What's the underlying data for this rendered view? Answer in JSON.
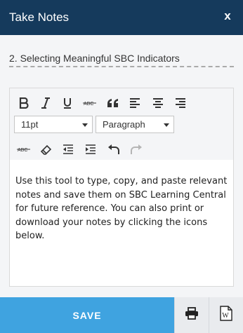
{
  "header": {
    "title": "Take Notes",
    "close_label": "x"
  },
  "title_field": {
    "value": "2. Selecting Meaningful SBC Indicators"
  },
  "toolbar": {
    "row1": [
      "bold-icon",
      "italic-icon",
      "underline-icon",
      "strikethrough-icon",
      "blockquote-icon",
      "align-left-icon",
      "align-center-icon",
      "align-right-icon"
    ],
    "font_size": "11pt",
    "format": "Paragraph",
    "row3": [
      "remove-format-icon",
      "eraser-icon",
      "outdent-icon",
      "indent-icon",
      "undo-icon",
      "redo-icon"
    ]
  },
  "editor": {
    "body": "Use this tool to type, copy, and paste relevant notes and save them on SBC Learning Central for future reference. You can also print or download your notes by clicking the icons below."
  },
  "footer": {
    "save_label": "SAVE",
    "print_icon": "print-icon",
    "word_icon": "word-doc-icon",
    "word_glyph": "W"
  },
  "colors": {
    "header_bg": "#153a5c",
    "save_bg": "#3fa3e0",
    "panel_bg": "#f4f5f7"
  }
}
